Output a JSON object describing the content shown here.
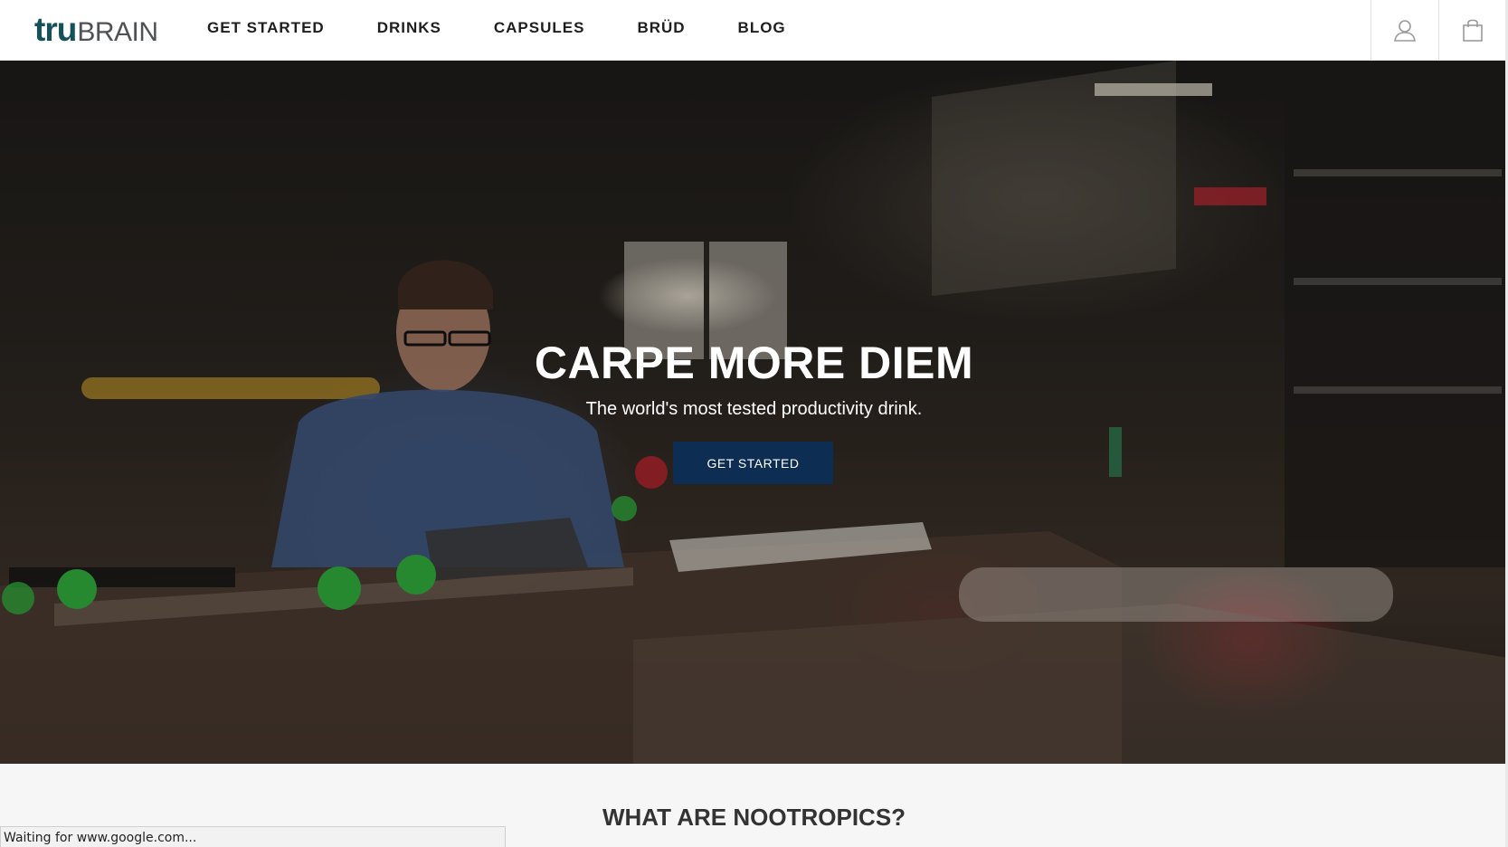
{
  "header": {
    "logo": {
      "part1": "tru",
      "part2": "BRAIN"
    },
    "nav": [
      {
        "label": "GET STARTED"
      },
      {
        "label": "DRINKS"
      },
      {
        "label": "CAPSULES"
      },
      {
        "label": "BRÜD"
      },
      {
        "label": "BLOG"
      }
    ],
    "icons": {
      "account": "user-icon",
      "cart": "shopping-bag-icon"
    }
  },
  "hero": {
    "title": "CARPE MORE DIEM",
    "subtitle": "The world's most tested productivity drink.",
    "cta_label": "GET STARTED",
    "cta_color": "#0d2e52"
  },
  "section": {
    "title": "WHAT ARE NOOTROPICS?"
  },
  "browser": {
    "status_text": "Waiting for www.google.com..."
  },
  "colors": {
    "logo_tru": "#14515a",
    "logo_brain": "#4f5255",
    "nav_text": "#1e1e1e",
    "page_bg": "#f6f6f6"
  }
}
